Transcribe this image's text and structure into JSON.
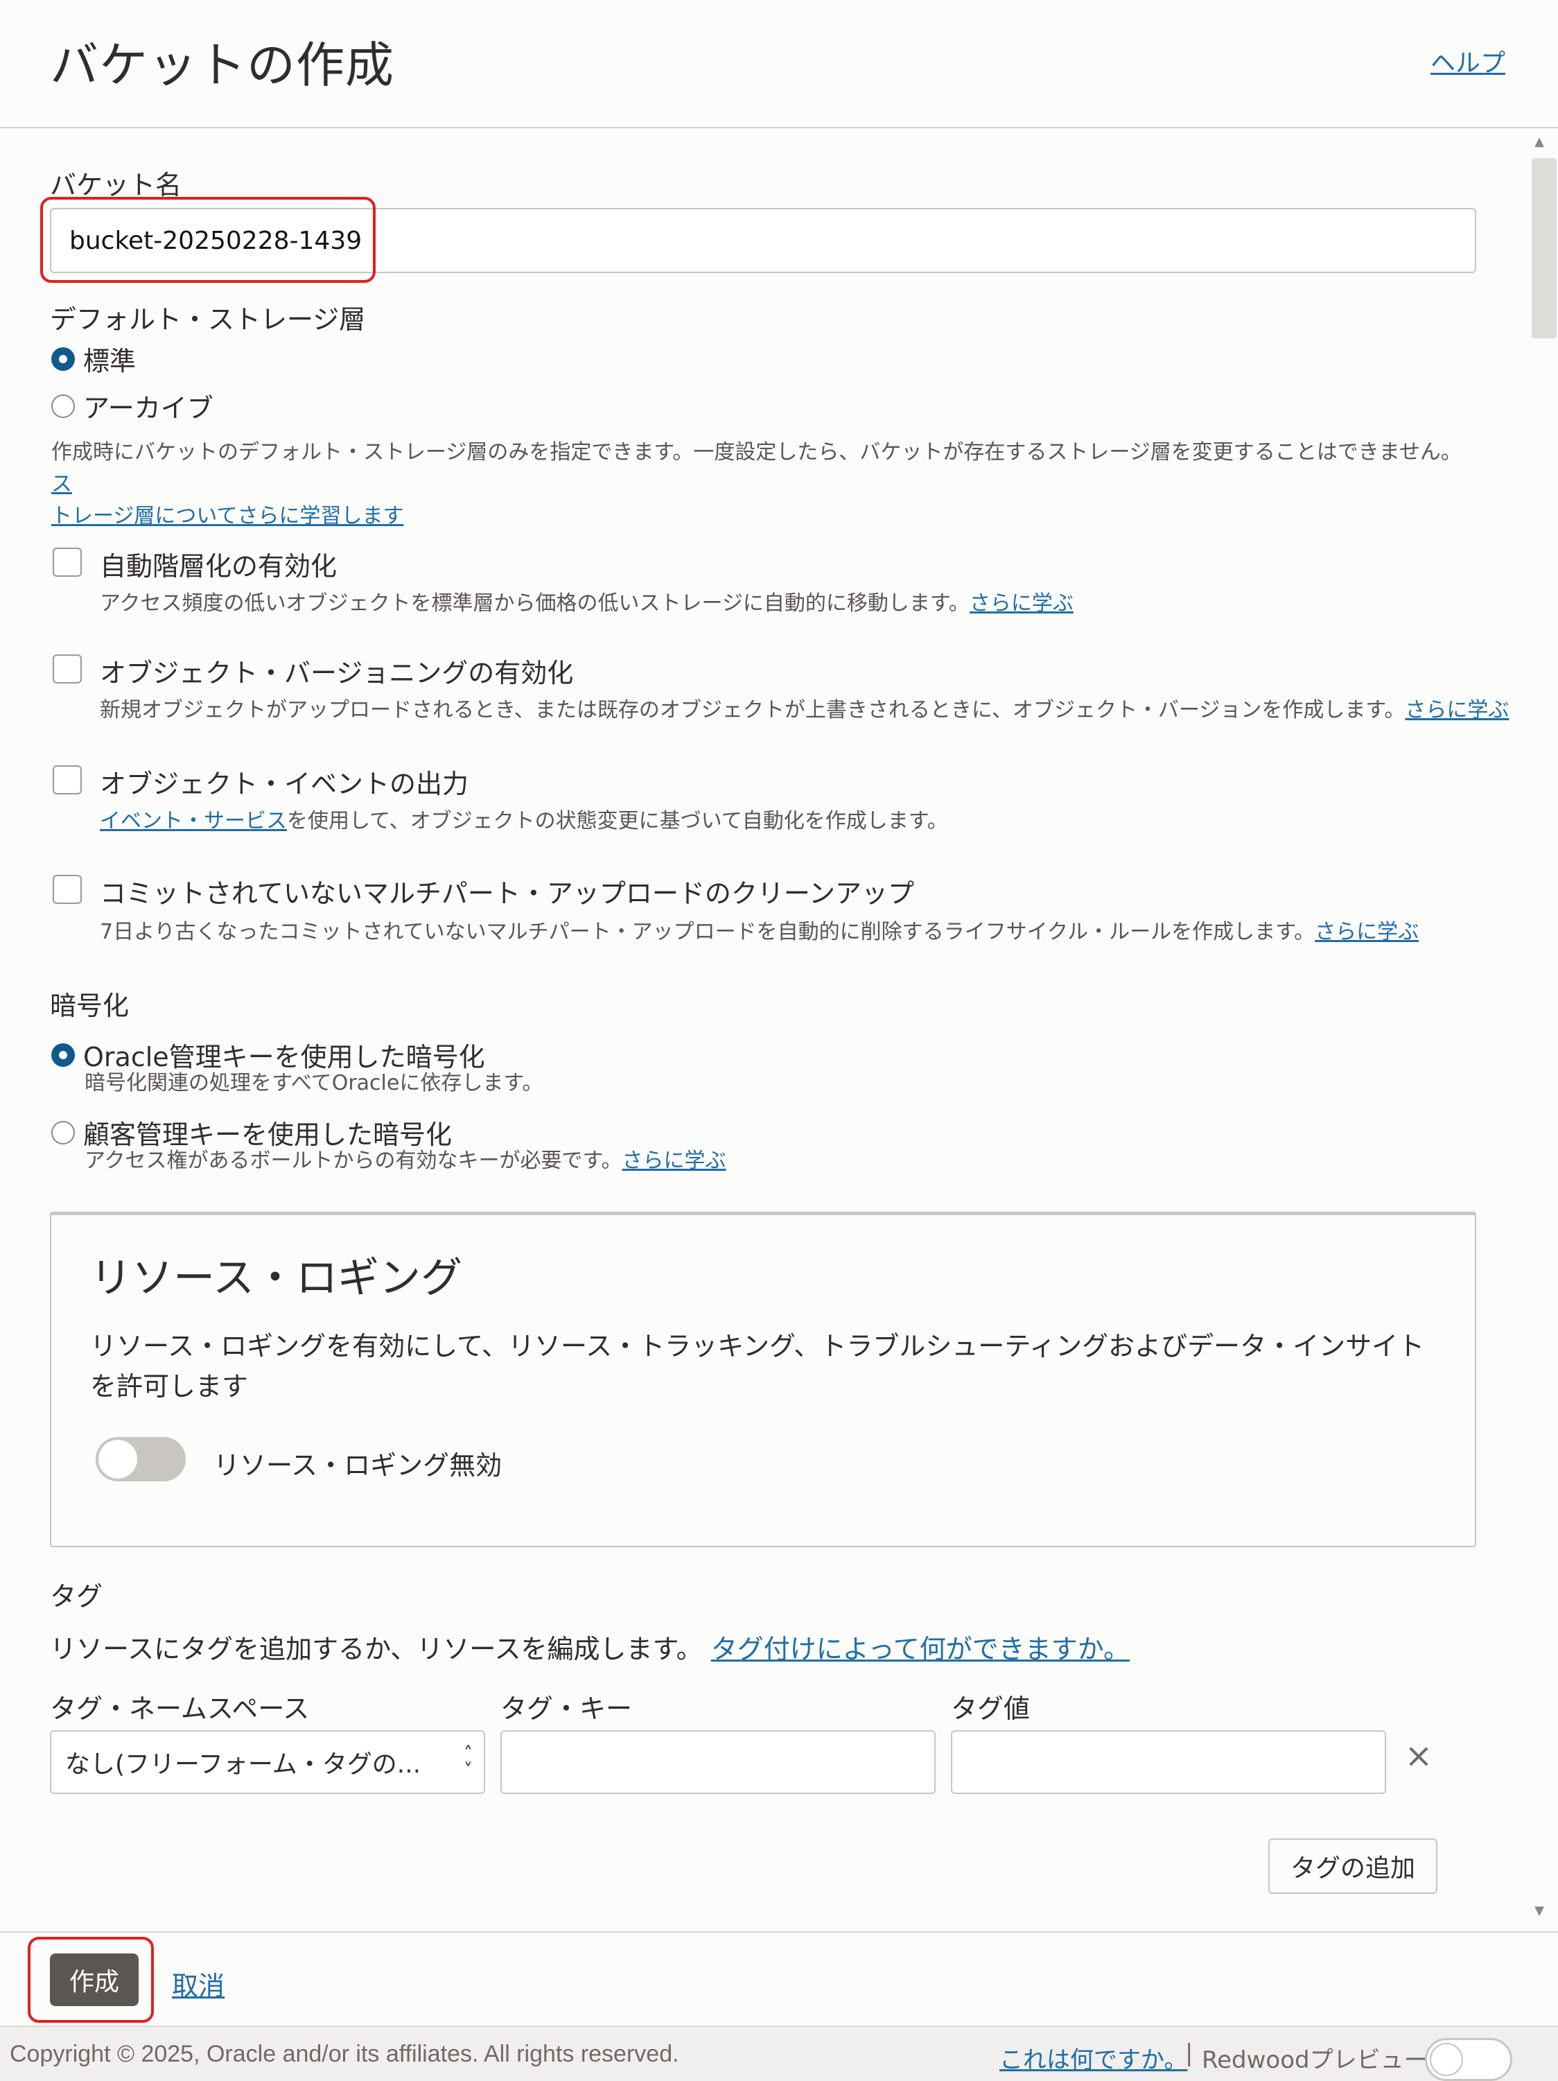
{
  "header": {
    "title": "バケットの作成",
    "help": "ヘルプ"
  },
  "bucket_name": {
    "label": "バケット名",
    "value": "bucket-20250228-1439"
  },
  "storage_tier": {
    "label": "デフォルト・ストレージ層",
    "options": [
      {
        "label": "標準",
        "selected": true
      },
      {
        "label": "アーカイブ",
        "selected": false
      }
    ],
    "help_line1": "作成時にバケットのデフォルト・ストレージ層のみを指定できます。一度設定したら、バケットが存在するストレージ層を変更することはできません。",
    "help_link_part1": "ス",
    "help_link_part2": "トレージ層についてさらに学習します"
  },
  "options": [
    {
      "label": "自動階層化の有効化",
      "desc": "アクセス頻度の低いオブジェクトを標準層から価格の低いストレージに自動的に移動します。",
      "link": "さらに学ぶ"
    },
    {
      "label": "オブジェクト・バージョニングの有効化",
      "desc": "新規オブジェクトがアップロードされるとき、または既存のオブジェクトが上書きされるときに、オブジェクト・バージョンを作成します。",
      "link": "さらに学ぶ"
    },
    {
      "label": "オブジェクト・イベントの出力",
      "desc_link": "イベント・サービス",
      "desc": "を使用して、オブジェクトの状態変更に基づいて自動化を作成します。"
    },
    {
      "label": "コミットされていないマルチパート・アップロードのクリーンアップ",
      "desc": "7日より古くなったコミットされていないマルチパート・アップロードを自動的に削除するライフサイクル・ルールを作成します。",
      "link": "さらに学ぶ"
    }
  ],
  "encryption": {
    "label": "暗号化",
    "options": [
      {
        "label": "Oracle管理キーを使用した暗号化",
        "desc": "暗号化関連の処理をすべてOracleに依存します。",
        "selected": true
      },
      {
        "label": "顧客管理キーを使用した暗号化",
        "desc": "アクセス権があるボールトからの有効なキーが必要です。",
        "link": "さらに学ぶ",
        "selected": false
      }
    ]
  },
  "resource_logging": {
    "title": "リソース・ロギング",
    "desc": "リソース・ロギングを有効にして、リソース・トラッキング、トラブルシューティングおよびデータ・インサイトを許可します",
    "toggle_label": "リソース・ロギング無効",
    "enabled": false
  },
  "tags": {
    "label": "タグ",
    "desc": "リソースにタグを追加するか、リソースを編成します。",
    "link": "タグ付けによって何ができますか。",
    "namespace_label": "タグ・ネームスペース",
    "key_label": "タグ・キー",
    "value_label": "タグ値",
    "namespace_value": "なし(フリーフォーム・タグの...",
    "key_value": "",
    "value_value": "",
    "add_button": "タグの追加"
  },
  "actions": {
    "create": "作成",
    "cancel": "取消"
  },
  "footer": {
    "copyright": "Copyright © 2025, Oracle and/or its affiliates. All rights reserved.",
    "whats_this": "これは何ですか。",
    "separator": "|",
    "redwood": "Redwoodプレビュー"
  },
  "colors": {
    "accent": "#0f5a8c",
    "link": "#1f6ea6",
    "highlight": "#e02020",
    "primary_button": "#5b5652"
  }
}
